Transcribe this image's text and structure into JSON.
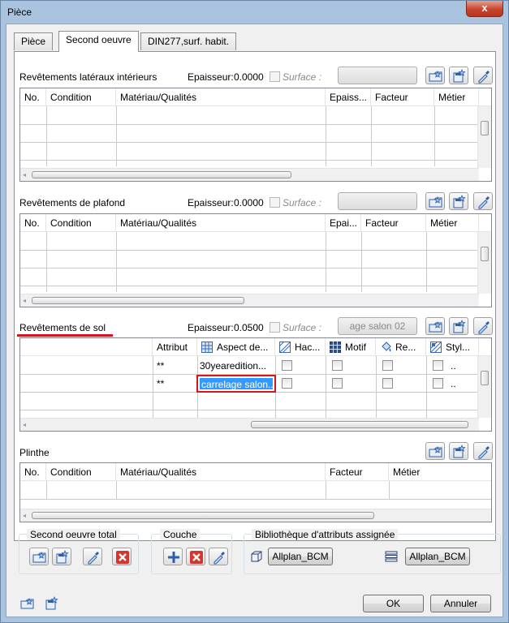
{
  "window": {
    "title": "Pièce",
    "close_glyph": "x"
  },
  "tabs": [
    {
      "label": "Pièce"
    },
    {
      "label": "Second oeuvre"
    },
    {
      "label": "DIN277,surf. habit."
    }
  ],
  "sections": {
    "lateral": {
      "label": "Revêtements latéraux intérieurs",
      "epaisseur_label": "Epaisseur:",
      "epaisseur_value": "0.0000",
      "surface_label": "Surface :",
      "surface_value": "",
      "columns": [
        "No.",
        "Condition",
        "Matériau/Qualités",
        "Epaiss...",
        "Facteur",
        "Métier"
      ]
    },
    "plafond": {
      "label": "Revêtements de plafond",
      "epaisseur_label": "Epaisseur:",
      "epaisseur_value": "0.0000",
      "surface_label": "Surface :",
      "surface_value": "",
      "columns": [
        "No.",
        "Condition",
        "Matériau/Qualités",
        "Epai...",
        "Facteur",
        "Métier"
      ]
    },
    "sol": {
      "label": "Revêtements de sol",
      "epaisseur_label": "Epaisseur:",
      "epaisseur_value": "0.0500",
      "surface_label": "Surface :",
      "surface_value": "age salon 02",
      "columns": [
        "",
        "Attribut",
        "Aspect de...",
        "Hac...",
        "Motif",
        "Re...",
        "Styl..."
      ],
      "rows": [
        {
          "attribut": "**",
          "aspect": "30yearedition...",
          "styl": ".."
        },
        {
          "attribut": "**",
          "aspect": "carrelage salon...",
          "styl": ".."
        }
      ]
    },
    "plinthe": {
      "label": "Plinthe",
      "columns": [
        "No.",
        "Condition",
        "Matériau/Qualités",
        "Facteur",
        "Métier"
      ]
    }
  },
  "groups": {
    "second_oeuvre_total": {
      "label": "Second oeuvre total"
    },
    "couche": {
      "label": "Couche"
    },
    "bibliotheque": {
      "label": "Bibliothèque d'attributs assignée",
      "btn1": "Allplan_BCM",
      "btn2": "Allplan_BCM"
    }
  },
  "footer": {
    "ok": "OK",
    "cancel": "Annuler"
  },
  "colors": {
    "accent_red": "#d9141c",
    "selection_blue": "#3399ff"
  }
}
